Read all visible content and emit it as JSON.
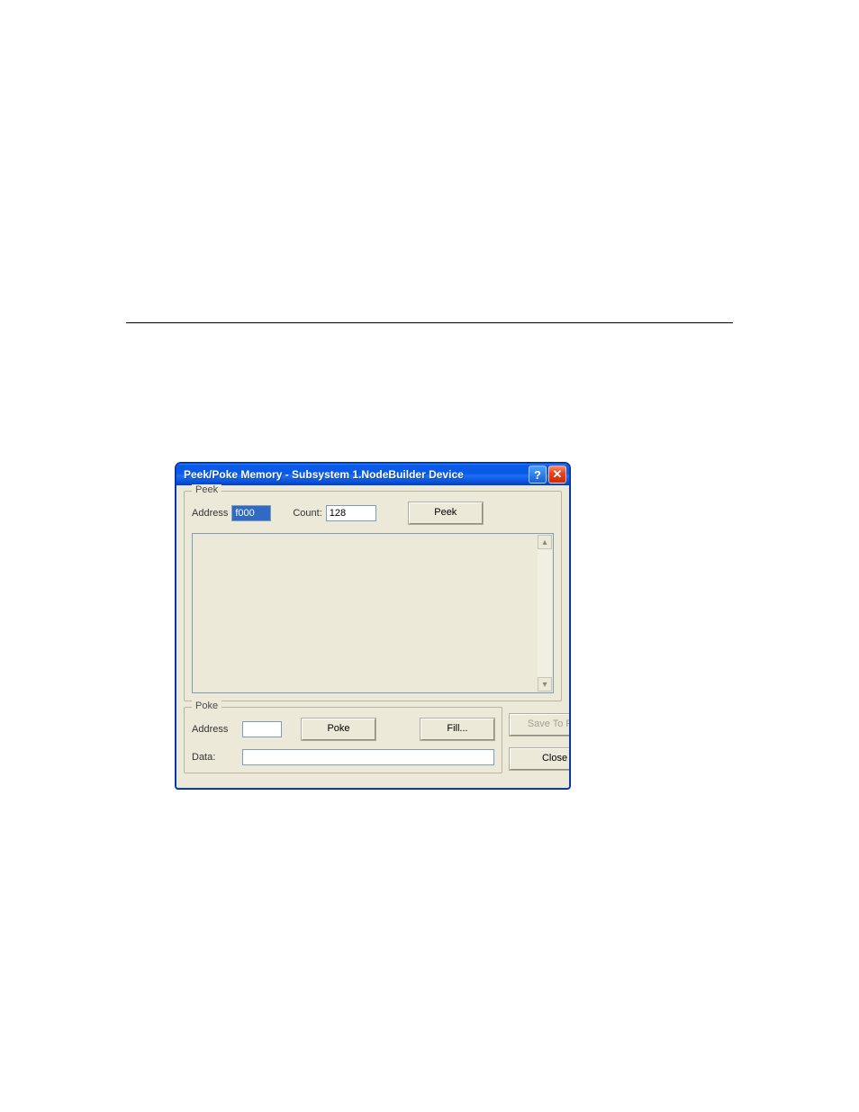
{
  "window": {
    "title": "Peek/Poke Memory - Subsystem 1.NodeBuilder Device"
  },
  "peek": {
    "legend": "Peek",
    "address_label": "Address",
    "address_value": "f000",
    "count_label": "Count:",
    "count_value": "128",
    "peek_button": "Peek"
  },
  "poke": {
    "legend": "Poke",
    "address_label": "Address",
    "address_value": "",
    "poke_button": "Poke",
    "fill_button": "Fill...",
    "data_label": "Data:",
    "data_value": ""
  },
  "side": {
    "save_button": "Save To File",
    "close_button": "Close"
  }
}
